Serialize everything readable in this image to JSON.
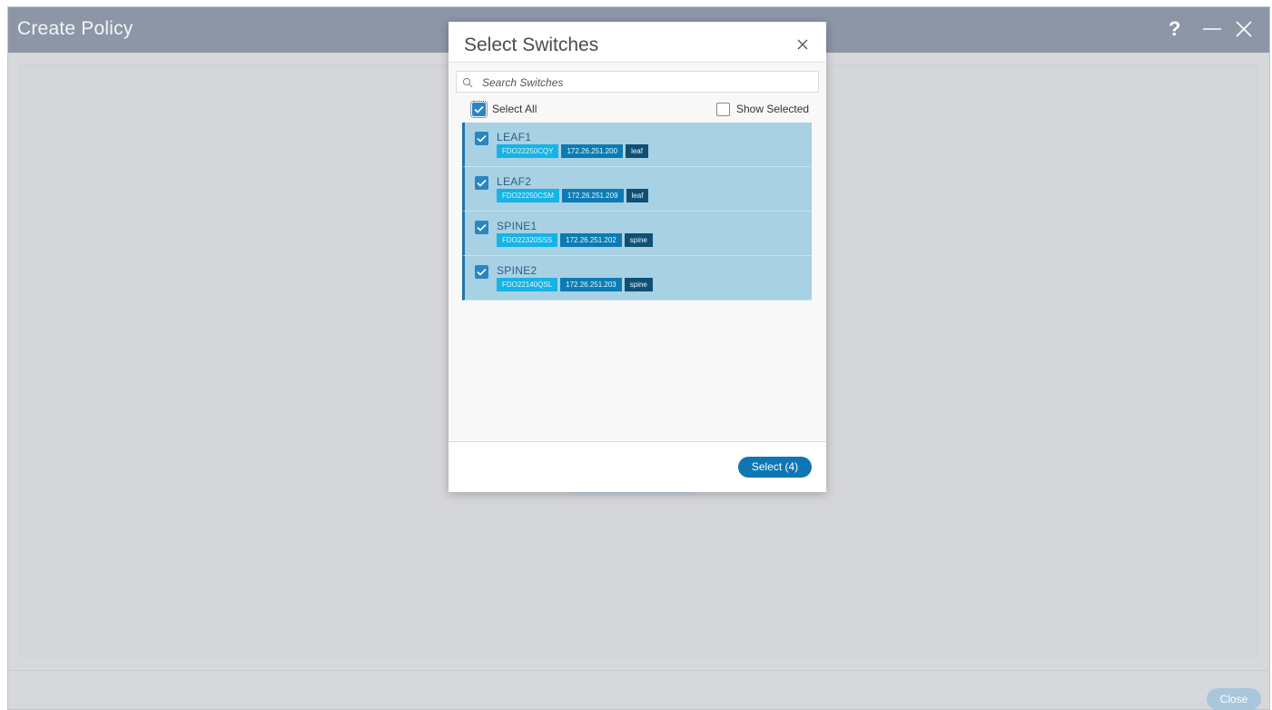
{
  "window": {
    "title": "Create Policy",
    "help_label": "?",
    "close_label": "Close"
  },
  "modal": {
    "title": "Select Switches",
    "search_placeholder": "Search Switches",
    "select_all_label": "Select All",
    "show_selected_label": "Show Selected",
    "select_button_label": "Select (4)",
    "switches": [
      {
        "name": "LEAF1",
        "serial": "FDO22250CQY",
        "ip": "172.26.251.200",
        "role": "leaf",
        "checked": true
      },
      {
        "name": "LEAF2",
        "serial": "FDO22250CSM",
        "ip": "172.26.251.209",
        "role": "leaf",
        "checked": true
      },
      {
        "name": "SPINE1",
        "serial": "FDO22320SSS",
        "ip": "172.26.251.202",
        "role": "spine",
        "checked": true
      },
      {
        "name": "SPINE2",
        "serial": "FDO22140QSL",
        "ip": "172.26.251.203",
        "role": "spine",
        "checked": true
      }
    ]
  },
  "colors": {
    "header_bg": "#8d96a6",
    "primary": "#0e76b2",
    "row_selected": "#a8d1e3"
  },
  "icons": [
    "help-icon",
    "minimize-icon",
    "close-icon",
    "search-icon",
    "checkbox-checked-icon",
    "checkbox-empty-icon"
  ]
}
